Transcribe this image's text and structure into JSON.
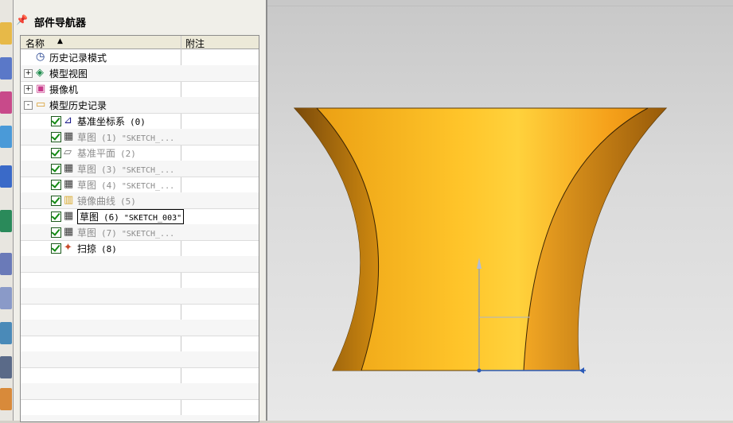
{
  "navigator": {
    "title": "部件导航器",
    "columns": {
      "name": "名称",
      "note": "附注"
    }
  },
  "tree": [
    {
      "label": "历史记录模式",
      "num": "",
      "sketch": "",
      "gray": false,
      "check": false,
      "expander": "",
      "indent": 0,
      "icon": "clock-icon"
    },
    {
      "label": "模型视图",
      "num": "",
      "sketch": "",
      "gray": false,
      "check": false,
      "expander": "+",
      "indent": 0,
      "icon": "model-view-icon"
    },
    {
      "label": "摄像机",
      "num": "",
      "sketch": "",
      "gray": false,
      "check": false,
      "expander": "+",
      "indent": 0,
      "icon": "camera-icon"
    },
    {
      "label": "模型历史记录",
      "num": "",
      "sketch": "",
      "gray": false,
      "check": false,
      "expander": "-",
      "indent": 0,
      "icon": "folder-icon"
    },
    {
      "label": "基准坐标系",
      "num": "(0)",
      "sketch": "",
      "gray": false,
      "check": true,
      "expander": "",
      "indent": 1,
      "icon": "datum-csys-icon"
    },
    {
      "label": "草图",
      "num": "(1)",
      "sketch": "\"SKETCH_...",
      "gray": true,
      "check": true,
      "expander": "",
      "indent": 1,
      "icon": "sketch-icon"
    },
    {
      "label": "基准平面",
      "num": "(2)",
      "sketch": "",
      "gray": true,
      "check": true,
      "expander": "",
      "indent": 1,
      "icon": "datum-plane-icon"
    },
    {
      "label": "草图",
      "num": "(3)",
      "sketch": "\"SKETCH_...",
      "gray": true,
      "check": true,
      "expander": "",
      "indent": 1,
      "icon": "sketch-icon"
    },
    {
      "label": "草图",
      "num": "(4)",
      "sketch": "\"SKETCH_...",
      "gray": true,
      "check": true,
      "expander": "",
      "indent": 1,
      "icon": "sketch-icon"
    },
    {
      "label": "镜像曲线",
      "num": "(5)",
      "sketch": "",
      "gray": true,
      "check": true,
      "expander": "",
      "indent": 1,
      "icon": "mirror-curve-icon"
    },
    {
      "label": "草图",
      "num": "(6)",
      "sketch": "\"SKETCH_003\"",
      "gray": false,
      "check": true,
      "expander": "",
      "indent": 1,
      "icon": "sketch-icon",
      "selected": true
    },
    {
      "label": "草图",
      "num": "(7)",
      "sketch": "\"SKETCH_...",
      "gray": true,
      "check": true,
      "expander": "",
      "indent": 1,
      "icon": "sketch-icon"
    },
    {
      "label": "扫掠",
      "num": "(8)",
      "sketch": "",
      "gray": false,
      "check": true,
      "expander": "",
      "indent": 1,
      "icon": "swept-icon"
    }
  ],
  "colors": {
    "solid_main": "#f7b21a",
    "solid_dark": "#9a5a08",
    "check_green": "#138a13"
  }
}
